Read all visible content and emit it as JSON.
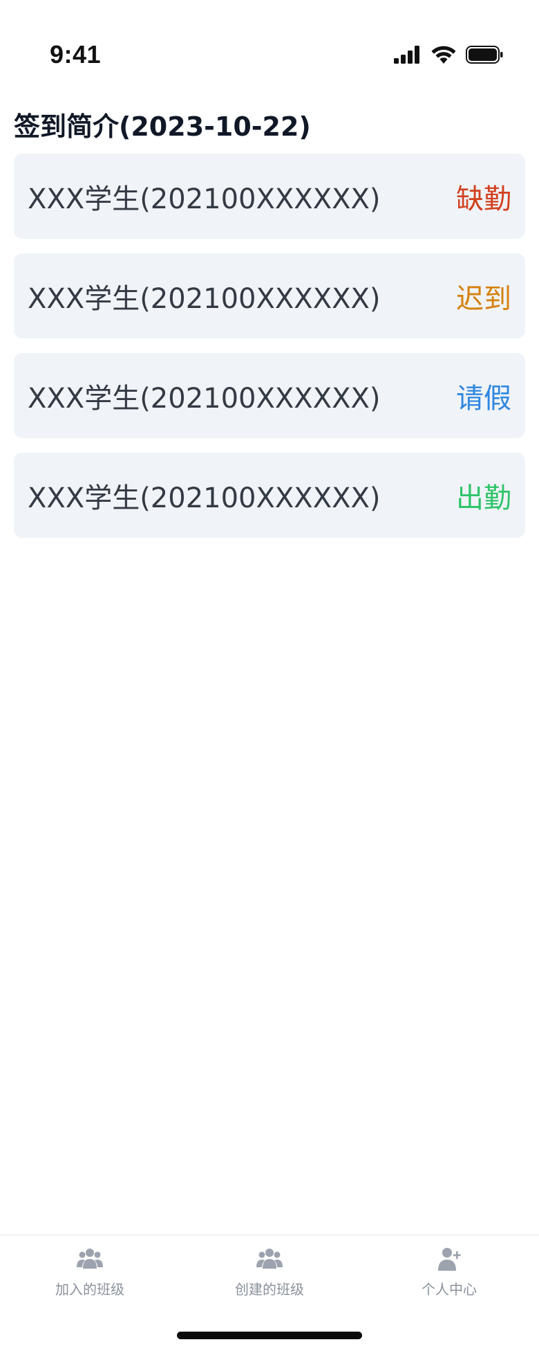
{
  "status_bar": {
    "time": "9:41",
    "icons": [
      "cellular-signal-icon",
      "wifi-icon",
      "battery-icon"
    ]
  },
  "page": {
    "title": "签到简介(2023-10-22)"
  },
  "attendance": [
    {
      "name": "XXX学生(202100XXXXXX)",
      "status": "缺勤",
      "status_color": "#d2401f"
    },
    {
      "name": "XXX学生(202100XXXXXX)",
      "status": "迟到",
      "status_color": "#d4810c"
    },
    {
      "name": "XXX学生(202100XXXXXX)",
      "status": "请假",
      "status_color": "#2f86e0"
    },
    {
      "name": "XXX学生(202100XXXXXX)",
      "status": "出勤",
      "status_color": "#2fc46a"
    }
  ],
  "tab_bar": {
    "tabs": [
      {
        "label": "加入的班级",
        "icon": "group-icon"
      },
      {
        "label": "创建的班级",
        "icon": "group-icon"
      },
      {
        "label": "个人中心",
        "icon": "user-add-icon"
      }
    ],
    "inactive_color": "#9ca3af"
  }
}
